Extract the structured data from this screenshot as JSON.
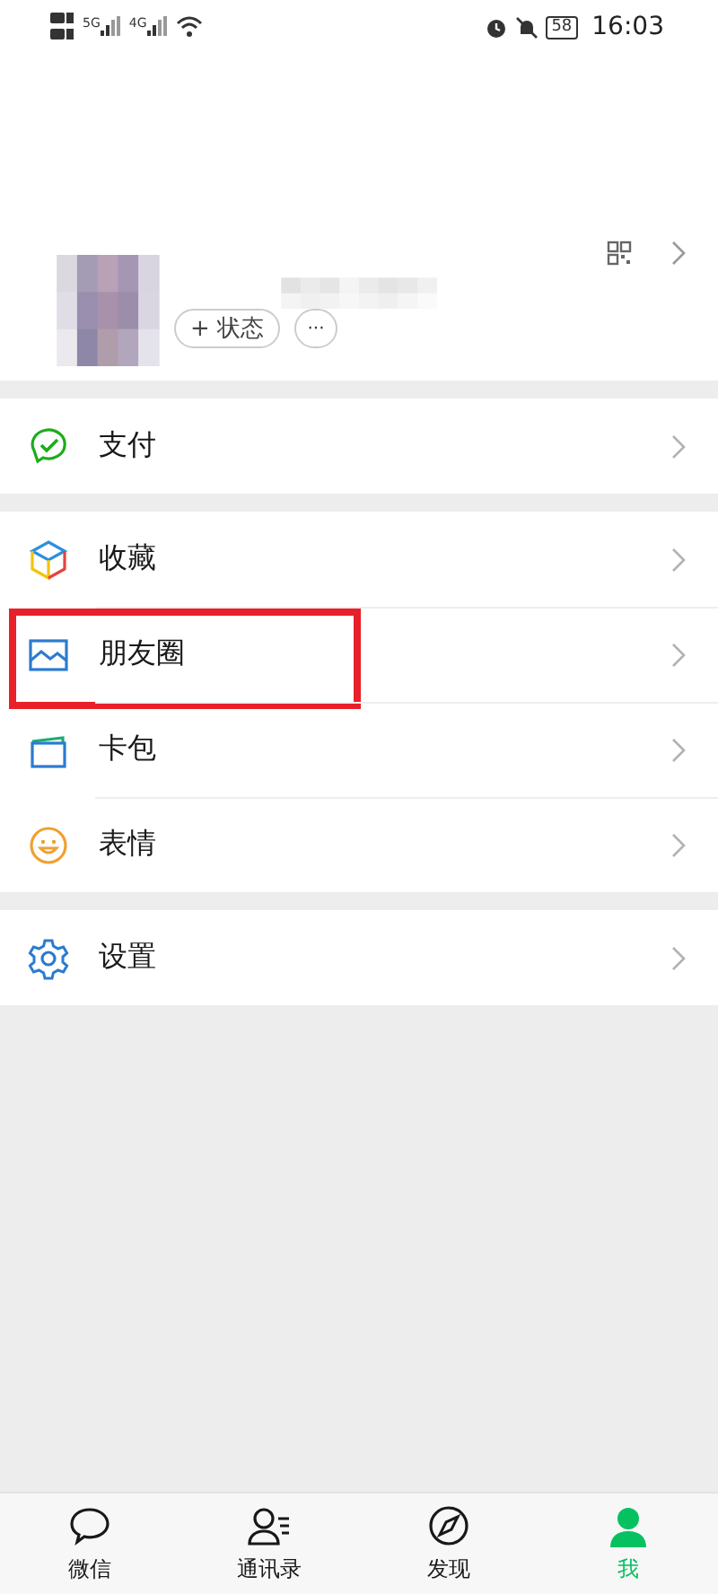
{
  "status_bar": {
    "networks": [
      "5G",
      "4G"
    ],
    "battery": "58",
    "time": "16:03"
  },
  "profile": {
    "status_button": "+ 状态",
    "more_button": "···"
  },
  "menu_groups": [
    [
      {
        "label": "支付",
        "highlighted": false
      }
    ],
    [
      {
        "label": "收藏",
        "highlighted": false
      },
      {
        "label": "朋友圈",
        "highlighted": true
      },
      {
        "label": "卡包",
        "highlighted": false
      },
      {
        "label": "表情",
        "highlighted": false
      }
    ],
    [
      {
        "label": "设置",
        "highlighted": false
      }
    ]
  ],
  "tabs": [
    {
      "label": "微信",
      "selected": false
    },
    {
      "label": "通讯录",
      "selected": false
    },
    {
      "label": "发现",
      "selected": false
    },
    {
      "label": "我",
      "selected": true
    }
  ]
}
